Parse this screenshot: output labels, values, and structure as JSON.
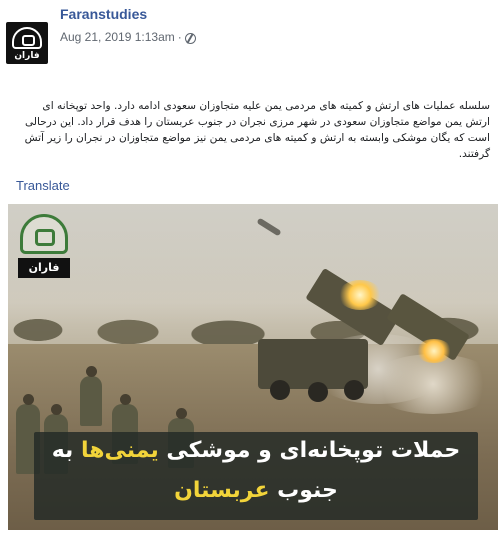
{
  "post": {
    "page_name": "Faranstudies",
    "timestamp": "Aug 21, 2019 1:13am",
    "separator": "·",
    "privacy_icon": "globe-icon",
    "avatar_label": "فاران",
    "text": "سلسله عملیات های ارتش و کمیته های مردمی یمن علیه متجاوزان سعودی ادامه دارد. واحد توپخانه ای ارتش یمن مواضع متجاوزان سعودی در شهر مرزی نجران در جنوب عربستان را هدف قرار داد. این درحالی است که یگان موشکی وابسته به ارتش و کمیته های مردمی یمن نیز مواضع متجاوزان در نجران را زیر آتش گرفتند.",
    "translate_label": "Translate"
  },
  "image": {
    "logo_label": "فاران",
    "caption_line1_part1": "حملات توپخانه‌ای و موشکی ",
    "caption_line1_highlight": "یمنی‌ها",
    "caption_line1_part2": " به",
    "caption_line2_part1": "جنوب ",
    "caption_line2_highlight": "عربستان",
    "highlight_color": "#f2d43a"
  }
}
